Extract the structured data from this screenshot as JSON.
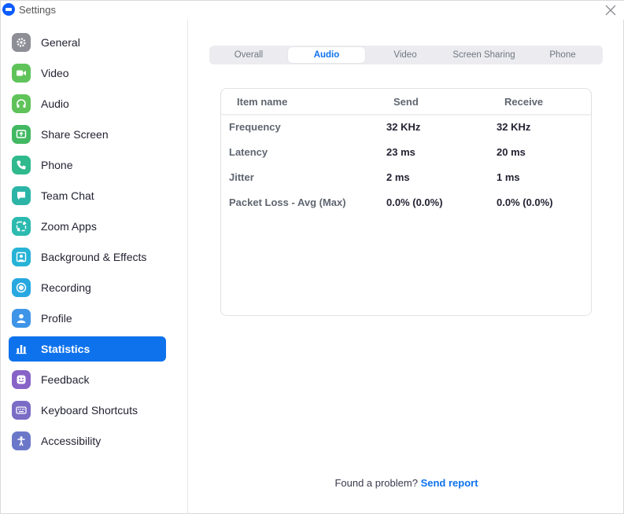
{
  "window": {
    "title": "Settings"
  },
  "sidebar": {
    "items": [
      {
        "label": "General",
        "icon": "gear-icon",
        "color": "#8e8e96"
      },
      {
        "label": "Video",
        "icon": "video-camera-icon",
        "color": "#5fc35a"
      },
      {
        "label": "Audio",
        "icon": "headphones-icon",
        "color": "#5fc35a"
      },
      {
        "label": "Share Screen",
        "icon": "share-screen-icon",
        "color": "#41b861"
      },
      {
        "label": "Phone",
        "icon": "phone-icon",
        "color": "#2fb98c"
      },
      {
        "label": "Team Chat",
        "icon": "chat-icon",
        "color": "#2cb5a6"
      },
      {
        "label": "Zoom Apps",
        "icon": "apps-icon",
        "color": "#2cbab0"
      },
      {
        "label": "Background & Effects",
        "icon": "background-icon",
        "color": "#27b3d6"
      },
      {
        "label": "Recording",
        "icon": "recording-icon",
        "color": "#27a8e0"
      },
      {
        "label": "Profile",
        "icon": "profile-icon",
        "color": "#3e95e8"
      },
      {
        "label": "Statistics",
        "icon": "bar-chart-icon",
        "color": "#0e72ed"
      },
      {
        "label": "Feedback",
        "icon": "smiley-icon",
        "color": "#8763c7"
      },
      {
        "label": "Keyboard Shortcuts",
        "icon": "keyboard-icon",
        "color": "#7b6cc6"
      },
      {
        "label": "Accessibility",
        "icon": "accessibility-icon",
        "color": "#6b78c9"
      }
    ],
    "active_index": 10
  },
  "tabs": {
    "items": [
      "Overall",
      "Audio",
      "Video",
      "Screen Sharing",
      "Phone"
    ],
    "active_index": 1
  },
  "stats": {
    "headers": {
      "name": "Item name",
      "send": "Send",
      "receive": "Receive"
    },
    "rows": [
      {
        "name": "Frequency",
        "send": "32 KHz",
        "receive": "32 KHz"
      },
      {
        "name": "Latency",
        "send": "23 ms",
        "receive": "20 ms"
      },
      {
        "name": "Jitter",
        "send": "2 ms",
        "receive": "1 ms"
      },
      {
        "name": "Packet Loss - Avg (Max)",
        "send": "0.0% (0.0%)",
        "receive": "0.0% (0.0%)"
      }
    ]
  },
  "footer": {
    "text": "Found a problem?",
    "link": "Send report"
  },
  "colors": {
    "accent": "#0e72ed"
  }
}
